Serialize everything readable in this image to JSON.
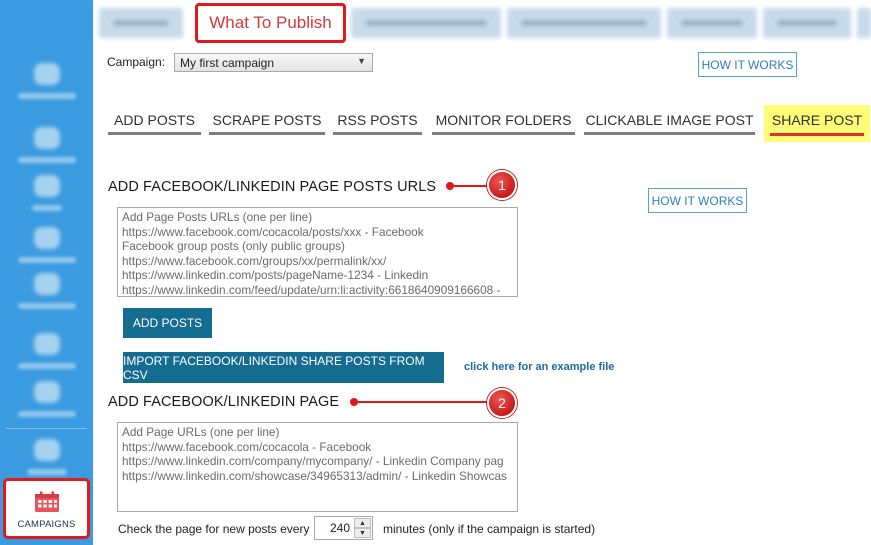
{
  "sidebar": {
    "items": [
      {
        "icon": "dashboard-icon"
      },
      {
        "icon": "social-networks-icon"
      },
      {
        "icon": "posts-icon"
      },
      {
        "icon": "spintax-icon"
      },
      {
        "icon": "schedule-icon"
      },
      {
        "icon": "rules-icon"
      },
      {
        "icon": "accounts-icon"
      },
      {
        "icon": "settings-icon"
      }
    ],
    "campaigns": {
      "label": "CAMPAIGNS",
      "icon": "calendar-icon",
      "color": "#e0191d"
    }
  },
  "top_tabs": {
    "active_label": "What To Publish"
  },
  "campaign": {
    "label": "Campaign:",
    "selected": "My first campaign"
  },
  "how_it_works_label": "HOW IT WORKS",
  "sub_tabs": [
    {
      "label": "ADD POSTS"
    },
    {
      "label": "SCRAPE POSTS"
    },
    {
      "label": "RSS POSTS"
    },
    {
      "label": "MONITOR FOLDERS"
    },
    {
      "label": "CLICKABLE IMAGE POST"
    },
    {
      "label": "SHARE POST"
    }
  ],
  "section1": {
    "heading": "ADD FACEBOOK/LINKEDIN PAGE POSTS URLS",
    "badge": "1",
    "textarea_lines": [
      "Add Page Posts URLs (one per line)",
      "https://www.facebook.com/cocacola/posts/xxx - Facebook",
      "Facebook group posts (only public groups)",
      "https://www.facebook.com/groups/xx/permalink/xx/",
      "https://www.linkedin.com/posts/pageName-1234 - Linkedin",
      "https://www.linkedin.com/feed/update/urn:li:activity:6618640909166608 -"
    ],
    "add_button": "ADD POSTS",
    "import_button": "IMPORT FACEBOOK/LINKEDIN SHARE POSTS FROM CSV",
    "example_link": "click here for an example file"
  },
  "section2": {
    "heading": "ADD FACEBOOK/LINKEDIN PAGE",
    "badge": "2",
    "textarea_lines": [
      "Add Page URLs (one per line)",
      "https://www.facebook.com/cocacola - Facebook",
      "https://www.linkedin.com/company/mycompany/ - Linkedin Company pag",
      "https://www.linkedin.com/showcase/34965313/admin/ - Linkedin Showcas"
    ]
  },
  "check": {
    "prefix": "Check the page for new posts every",
    "value": "240",
    "suffix": "minutes (only if the campaign is started)"
  },
  "colors": {
    "sidebar": "#3b9be0",
    "highlight_red": "#e0191d",
    "active_tab_bg": "#fdfd76",
    "button_blue": "#146c91"
  }
}
